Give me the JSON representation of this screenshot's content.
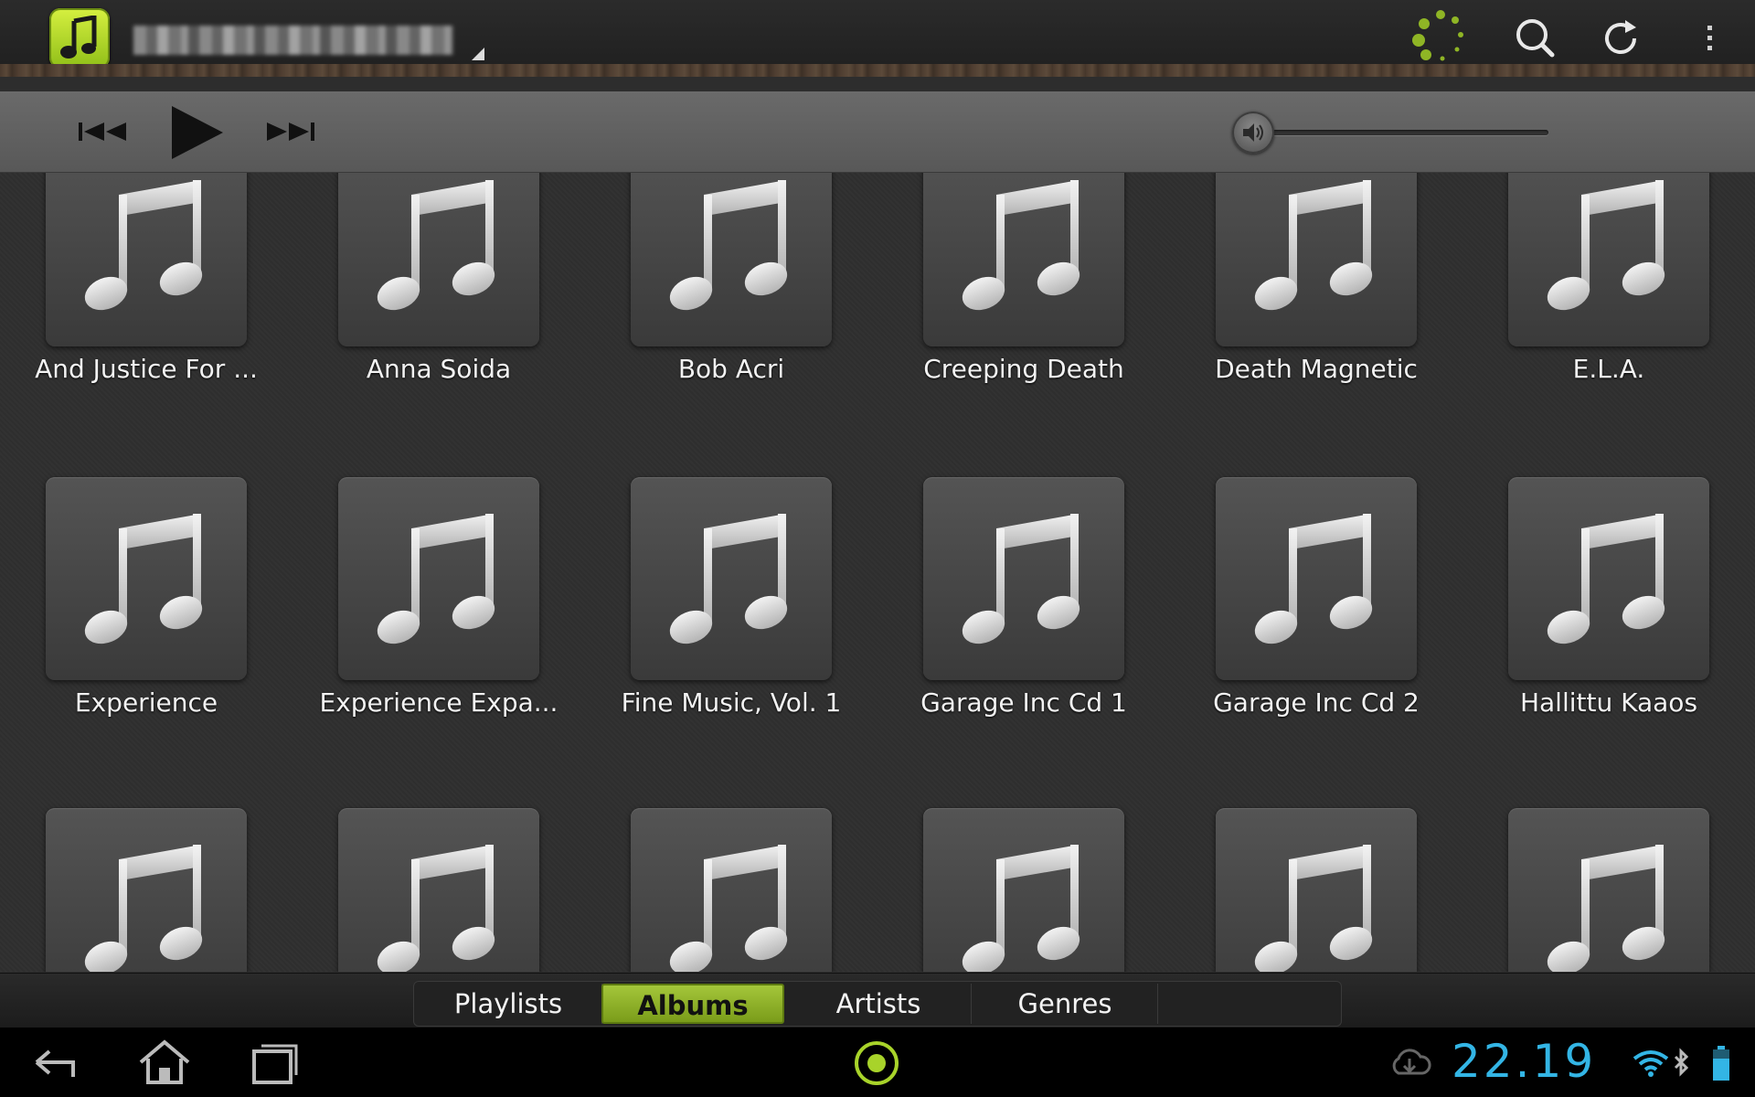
{
  "app": {
    "title": "",
    "colors": {
      "accent": "#8fb525",
      "clock": "#33b5e5"
    }
  },
  "actionbar": {
    "icons": [
      "app-logo-icon",
      "loading-spinner-icon",
      "search-icon",
      "refresh-icon",
      "overflow-menu-icon"
    ]
  },
  "player": {
    "icons": [
      "previous-track-icon",
      "play-icon",
      "next-track-icon",
      "volume-icon"
    ]
  },
  "albums": [
    "And Justice For ...",
    "Anna Soida",
    "Bob Acri",
    "Creeping Death",
    "Death Magnetic",
    "E.L.A.",
    "Experience",
    "Experience Expa...",
    "Fine Music, Vol. 1",
    "Garage Inc Cd 1",
    "Garage Inc Cd 2",
    "Hallittu Kaaos",
    "",
    "",
    "",
    "",
    "",
    ""
  ],
  "tabs": [
    {
      "label": "Playlists",
      "active": false
    },
    {
      "label": "Albums",
      "active": true
    },
    {
      "label": "Artists",
      "active": false
    },
    {
      "label": "Genres",
      "active": false
    }
  ],
  "system": {
    "time": "22.19",
    "icons": [
      "back-icon",
      "home-icon",
      "recent-apps-icon",
      "center-ring-icon",
      "cloud-download-icon",
      "wifi-icon",
      "bluetooth-icon",
      "battery-icon"
    ]
  }
}
